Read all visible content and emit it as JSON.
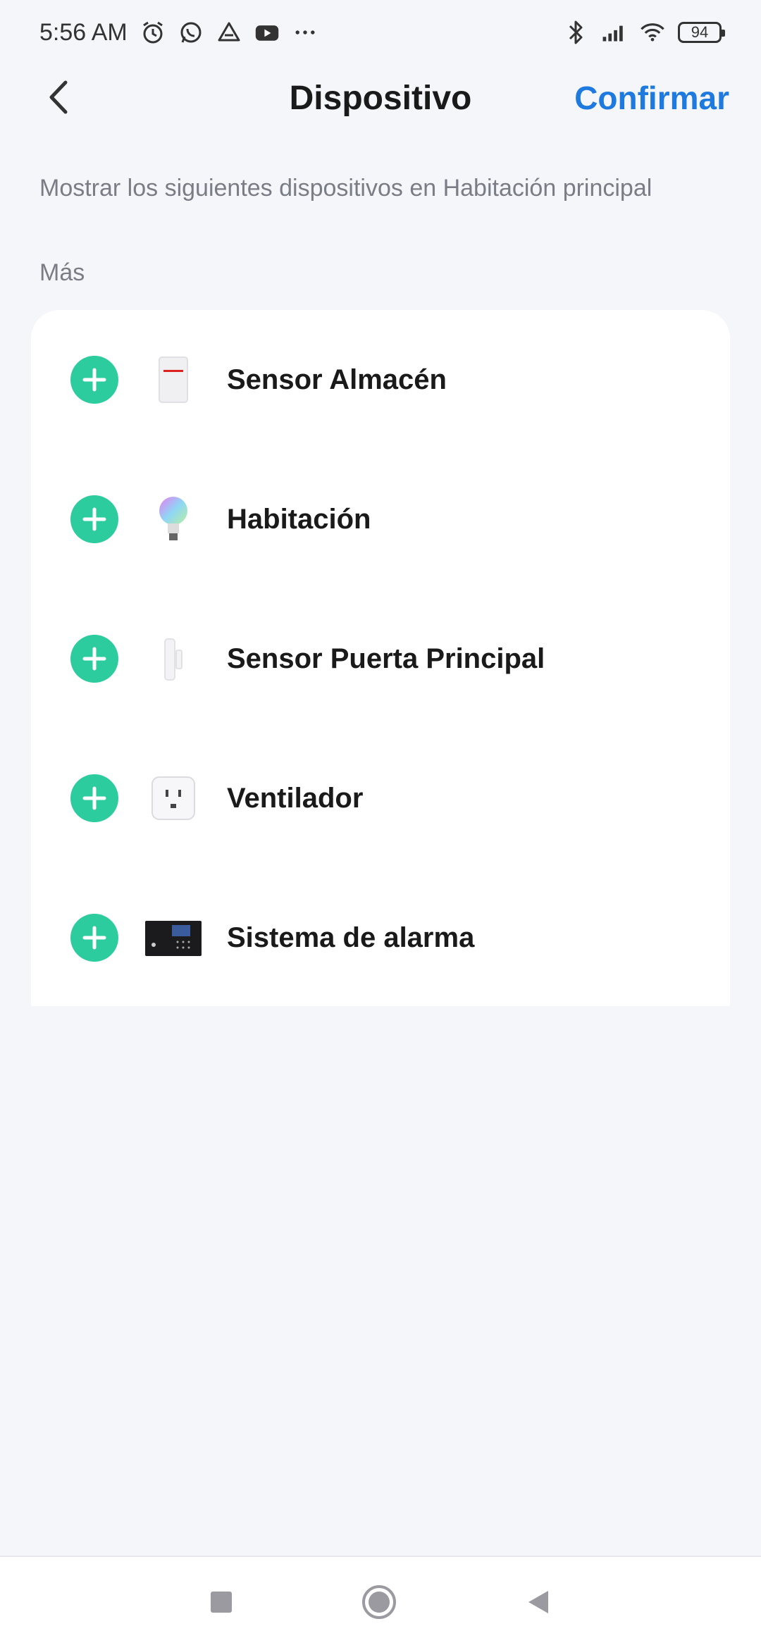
{
  "status_bar": {
    "time": "5:56 AM",
    "battery": "94",
    "icons": [
      "alarm-icon",
      "whatsapp-icon",
      "drive-icon",
      "youtube-icon",
      "more-dots-icon",
      "bluetooth-icon",
      "signal-icon",
      "wifi-icon",
      "battery-icon"
    ]
  },
  "header": {
    "title": "Dispositivo",
    "confirm_label": "Confirmar"
  },
  "subtitle": "Mostrar los siguientes dispositivos en Habitación principal",
  "section_label": "Más",
  "devices": [
    {
      "name": "Sensor Almacén",
      "icon": "motion-sensor-icon"
    },
    {
      "name": "Habitación",
      "icon": "rgb-bulb-icon"
    },
    {
      "name": "Sensor Puerta Principal",
      "icon": "door-sensor-icon"
    },
    {
      "name": "Ventilador",
      "icon": "smart-plug-icon"
    },
    {
      "name": "Sistema de alarma",
      "icon": "alarm-panel-icon"
    }
  ],
  "colors": {
    "accent": "#1f7ae0",
    "add_button": "#2dcc9f",
    "background": "#f5f6fa"
  }
}
